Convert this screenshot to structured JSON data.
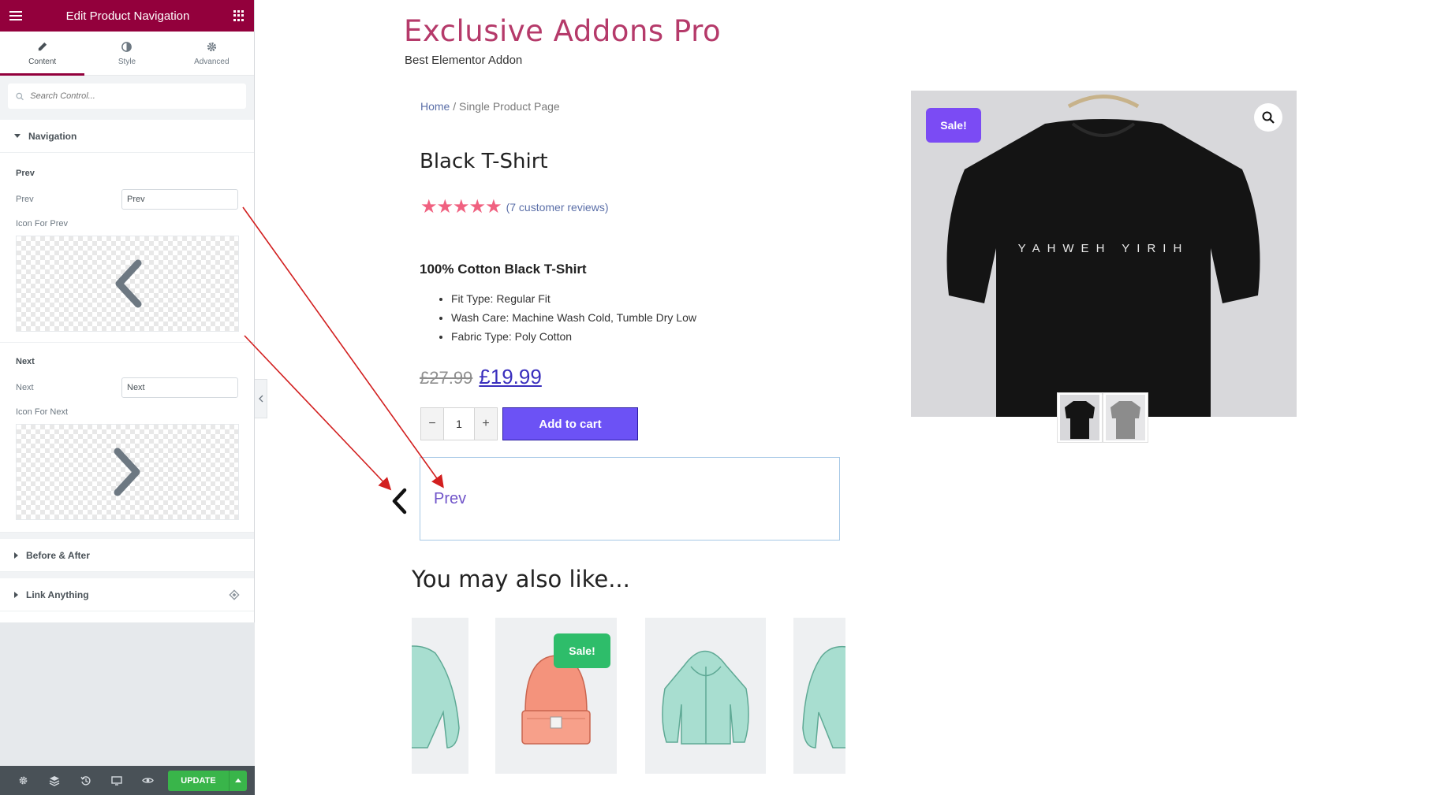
{
  "editor": {
    "title": "Edit Product Navigation",
    "tabs": [
      {
        "label": "Content",
        "icon": "pencil-icon"
      },
      {
        "label": "Style",
        "icon": "half-circle-icon"
      },
      {
        "label": "Advanced",
        "icon": "gear-icon"
      }
    ],
    "search_placeholder": "Search Control...",
    "sections": {
      "navigation": "Navigation",
      "before_after": "Before & After",
      "link_anything": "Link Anything"
    },
    "prev": {
      "heading": "Prev",
      "field_label": "Prev",
      "field_value": "Prev",
      "icon_label": "Icon For Prev"
    },
    "next": {
      "heading": "Next",
      "field_label": "Next",
      "field_value": "Next",
      "icon_label": "Icon For Next"
    },
    "footer": {
      "update_label": "UPDATE"
    }
  },
  "site": {
    "title": "Exclusive Addons Pro",
    "tagline": "Best Elementor Addon"
  },
  "breadcrumb": {
    "home": "Home",
    "separator": " / ",
    "current": "Single Product Page"
  },
  "product": {
    "title": "Black T-Shirt",
    "stars": "★★★★★",
    "rating": 4.5,
    "reviews": "(7 customer reviews)",
    "description_title": "100% Cotton Black T-Shirt",
    "features": [
      "Fit Type: Regular Fit",
      "Wash Care: Machine Wash Cold, Tumble Dry Low",
      "Fabric Type: Poly Cotton"
    ],
    "price_old": "£27.99",
    "price_new": "£19.99",
    "quantity": "1",
    "add_to_cart": "Add to cart",
    "sale_badge": "Sale!",
    "shirt_print": "YAHWEH YIRIH"
  },
  "navigation_widget": {
    "prev_text": "Prev"
  },
  "related": {
    "title": "You may also like...",
    "sale_badge": "Sale!"
  },
  "colors": {
    "editor_header": "#93003c",
    "site_title": "#b53a6a",
    "add_to_cart": "#6c52f5",
    "sale_purple": "#7b4bf4",
    "sale_green": "#2ebd6a",
    "annotation_arrow": "#d21f1f"
  }
}
